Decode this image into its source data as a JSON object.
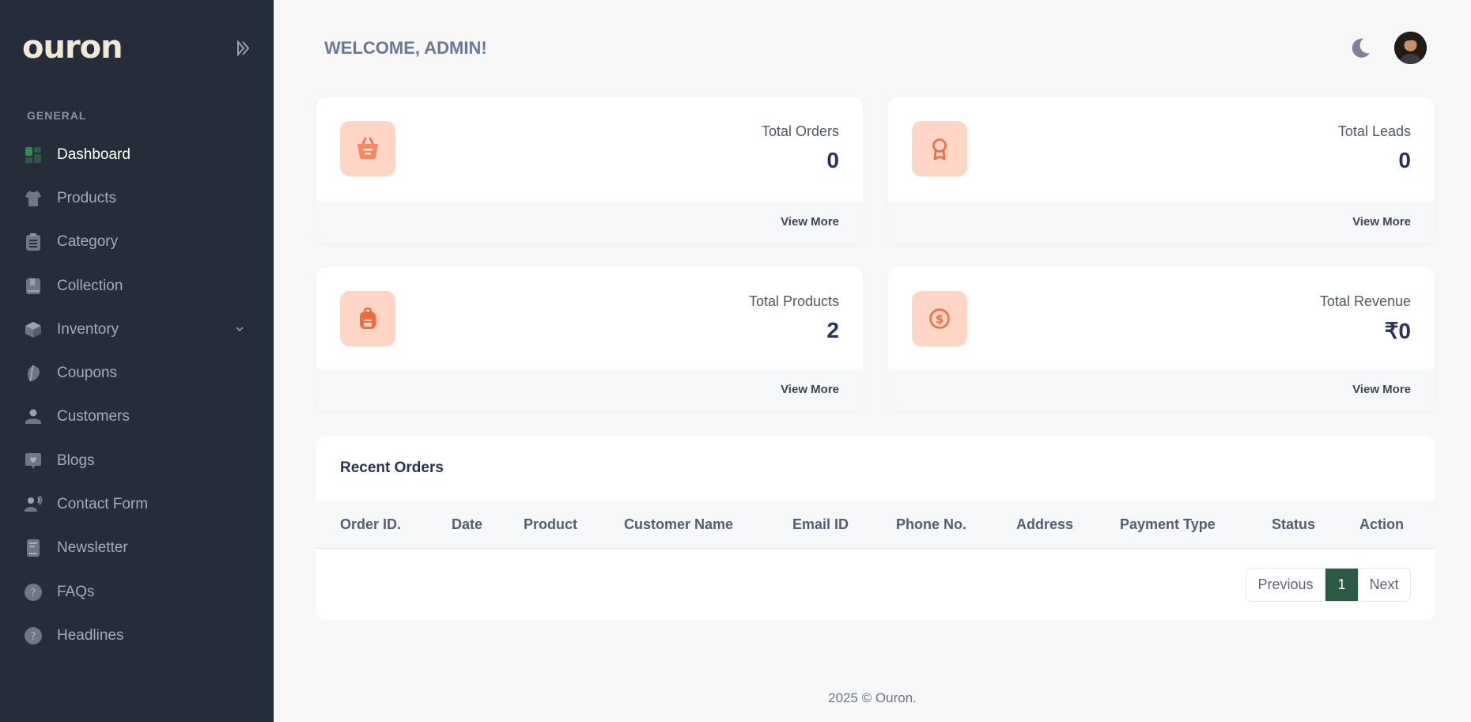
{
  "app": {
    "logo_text": "ouron"
  },
  "sidebar": {
    "section_title": "GENERAL",
    "items": [
      {
        "label": "Dashboard",
        "icon": "dashboard-icon",
        "active": true
      },
      {
        "label": "Products",
        "icon": "shirt-icon"
      },
      {
        "label": "Category",
        "icon": "clipboard-list-icon"
      },
      {
        "label": "Collection",
        "icon": "book-icon"
      },
      {
        "label": "Inventory",
        "icon": "box-icon",
        "has_submenu": true
      },
      {
        "label": "Coupons",
        "icon": "leaf-icon"
      },
      {
        "label": "Customers",
        "icon": "user-icon"
      },
      {
        "label": "Blogs",
        "icon": "heart-chat-icon"
      },
      {
        "label": "Contact Form",
        "icon": "contact-icon"
      },
      {
        "label": "Newsletter",
        "icon": "newsletter-icon"
      },
      {
        "label": "FAQs",
        "icon": "question-icon"
      },
      {
        "label": "Headlines",
        "icon": "question-icon"
      }
    ]
  },
  "header": {
    "welcome": "WELCOME, ADMIN!"
  },
  "stats": [
    {
      "label": "Total Orders",
      "value": "0",
      "link": "View More",
      "icon": "basket-icon"
    },
    {
      "label": "Total Leads",
      "value": "0",
      "link": "View More",
      "icon": "award-icon"
    },
    {
      "label": "Total Products",
      "value": "2",
      "link": "View More",
      "icon": "backpack-icon"
    },
    {
      "label": "Total Revenue",
      "value": "₹0",
      "link": "View More",
      "icon": "dollar-coin-icon"
    }
  ],
  "orders": {
    "title": "Recent Orders",
    "columns": [
      "Order ID.",
      "Date",
      "Product",
      "Customer Name",
      "Email ID",
      "Phone No.",
      "Address",
      "Payment Type",
      "Status",
      "Action"
    ],
    "rows": [],
    "pagination": {
      "previous": "Previous",
      "current": "1",
      "next": "Next"
    }
  },
  "footer": {
    "text": "2025 © Ouron."
  },
  "colors": {
    "sidebar_bg": "#262d3a",
    "accent": "#2d5a45",
    "icon_bg": "#ffd6c6",
    "icon_fg": "#f26b3a"
  }
}
